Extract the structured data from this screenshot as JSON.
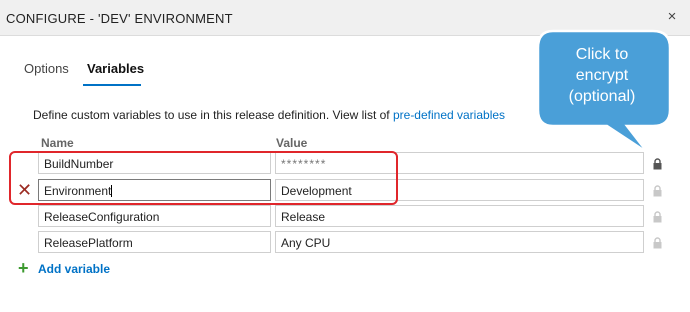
{
  "window": {
    "title": "CONFIGURE - 'DEV' ENVIRONMENT",
    "close_glyph": "×"
  },
  "tabs": [
    {
      "label": "Options",
      "active": false
    },
    {
      "label": "Variables",
      "active": true
    }
  ],
  "description": {
    "text": "Define custom variables to use in this release definition. View list of ",
    "link": "pre-defined variables"
  },
  "table": {
    "headers": {
      "name": "Name",
      "value": "Value"
    },
    "rows": [
      {
        "name": "BuildNumber",
        "value": "********",
        "secret": true
      },
      {
        "name": "Environment",
        "value": "Development",
        "secret": false,
        "focused": true
      },
      {
        "name": "ReleaseConfiguration",
        "value": "Release",
        "secret": false
      },
      {
        "name": "ReleasePlatform",
        "value": "Any CPU",
        "secret": false
      }
    ]
  },
  "add_variable": {
    "label": "Add variable",
    "icon": "plus-icon"
  },
  "delete_icon": "✕",
  "callout": {
    "lines": [
      "Click to",
      "encrypt",
      "(optional)"
    ]
  },
  "colors": {
    "accent": "#0072c6",
    "highlight": "#e0262b",
    "callout_fill": "#4a9fd8",
    "delete": "#9b2b22",
    "add": "#3c9a2f"
  }
}
